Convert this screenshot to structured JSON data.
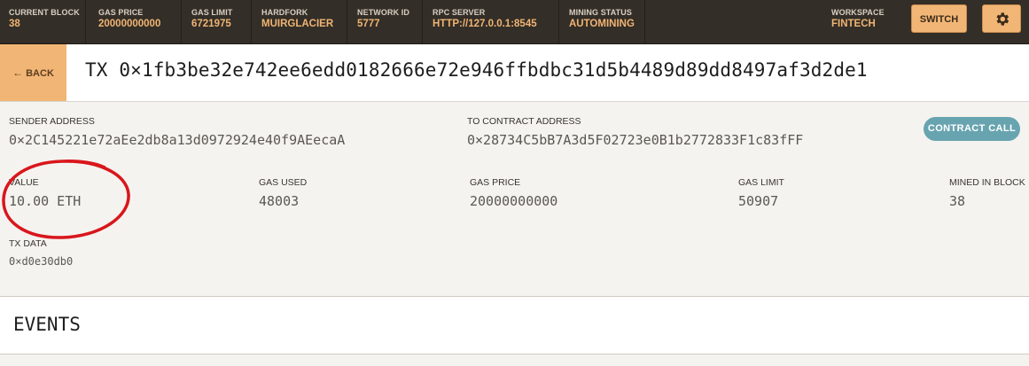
{
  "topbar": {
    "stats": [
      {
        "label": "CURRENT BLOCK",
        "value": "38"
      },
      {
        "label": "GAS PRICE",
        "value": "20000000000"
      },
      {
        "label": "GAS LIMIT",
        "value": "6721975"
      },
      {
        "label": "HARDFORK",
        "value": "MUIRGLACIER"
      },
      {
        "label": "NETWORK ID",
        "value": "5777"
      },
      {
        "label": "RPC SERVER",
        "value": "HTTP://127.0.0.1:8545"
      },
      {
        "label": "MINING STATUS",
        "value": "AUTOMINING"
      },
      {
        "label": "WORKSPACE",
        "value": "FINTECH"
      }
    ],
    "switch_label": "SWITCH",
    "settings_icon": "gear-icon"
  },
  "header": {
    "back_arrow": "←",
    "back_label": "BACK",
    "tx_title": "TX 0×1fb3be32e742ee6edd0182666e72e946ffbdbc31d5b4489d89dd8497af3d2de1"
  },
  "details": {
    "sender": {
      "label": "SENDER ADDRESS",
      "value": "0×2C145221e72aEe2db8a13d0972924e40f9AEecaA"
    },
    "to_contract": {
      "label": "TO CONTRACT ADDRESS",
      "value": "0×28734C5bB7A3d5F02723e0B1b2772833F1c83fFF"
    },
    "badge": "CONTRACT CALL",
    "value": {
      "label": "VALUE",
      "value": "10.00 ETH"
    },
    "gas_used": {
      "label": "GAS USED",
      "value": "48003"
    },
    "gas_price": {
      "label": "GAS PRICE",
      "value": "20000000000"
    },
    "gas_limit": {
      "label": "GAS LIMIT",
      "value": "50907"
    },
    "mined_in_block": {
      "label": "MINED IN BLOCK",
      "value": "38"
    },
    "tx_data": {
      "label": "TX DATA",
      "value": "0×d0e30db0"
    },
    "annotation_color": "#d9161c"
  },
  "events": {
    "title": "EVENTS"
  },
  "colors": {
    "topbar_bg": "#332e27",
    "accent": "#f1b676",
    "badge": "#68a4b0"
  }
}
